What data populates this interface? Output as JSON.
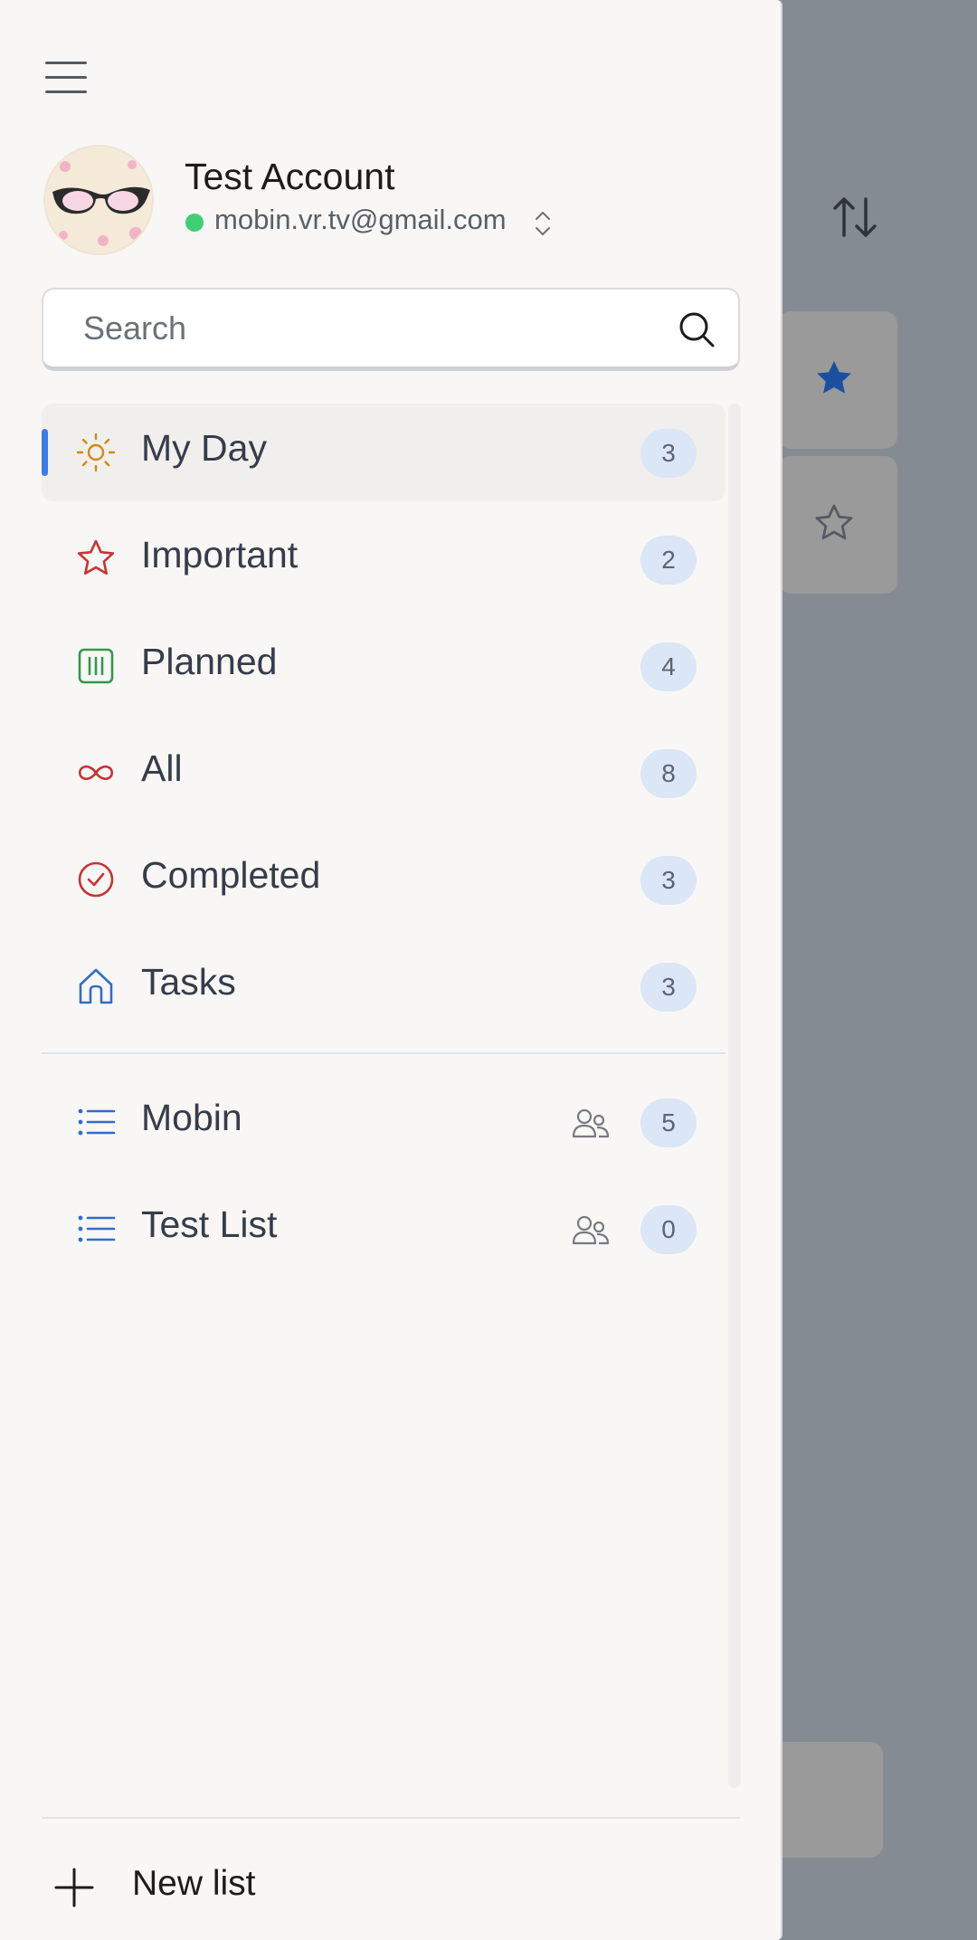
{
  "account": {
    "name": "Test Account",
    "email": "mobin.vr.tv@gmail.com",
    "status_color": "#3fcf76"
  },
  "search": {
    "placeholder": "Search"
  },
  "smart_lists": [
    {
      "label": "My Day",
      "count": "3",
      "icon": "sun-icon",
      "active": true
    },
    {
      "label": "Important",
      "count": "2",
      "icon": "star-icon"
    },
    {
      "label": "Planned",
      "count": "4",
      "icon": "calendar-icon"
    },
    {
      "label": "All",
      "count": "8",
      "icon": "infinity-icon"
    },
    {
      "label": "Completed",
      "count": "3",
      "icon": "check-circle-icon"
    },
    {
      "label": "Tasks",
      "count": "3",
      "icon": "home-icon"
    }
  ],
  "user_lists": [
    {
      "label": "Mobin",
      "count": "5",
      "icon": "list-icon",
      "shared_icon": "people-icon"
    },
    {
      "label": "Test List",
      "count": "0",
      "icon": "list-icon",
      "shared_icon": "people-icon"
    }
  ],
  "footer": {
    "new_list_label": "New list"
  },
  "colors": {
    "accent": "#3b7be8",
    "count_badge": "#dbe6f6",
    "drawer_bg": "#f9f7f5",
    "overlay_bg": "#858b93",
    "starred": "#1b4fa0"
  }
}
